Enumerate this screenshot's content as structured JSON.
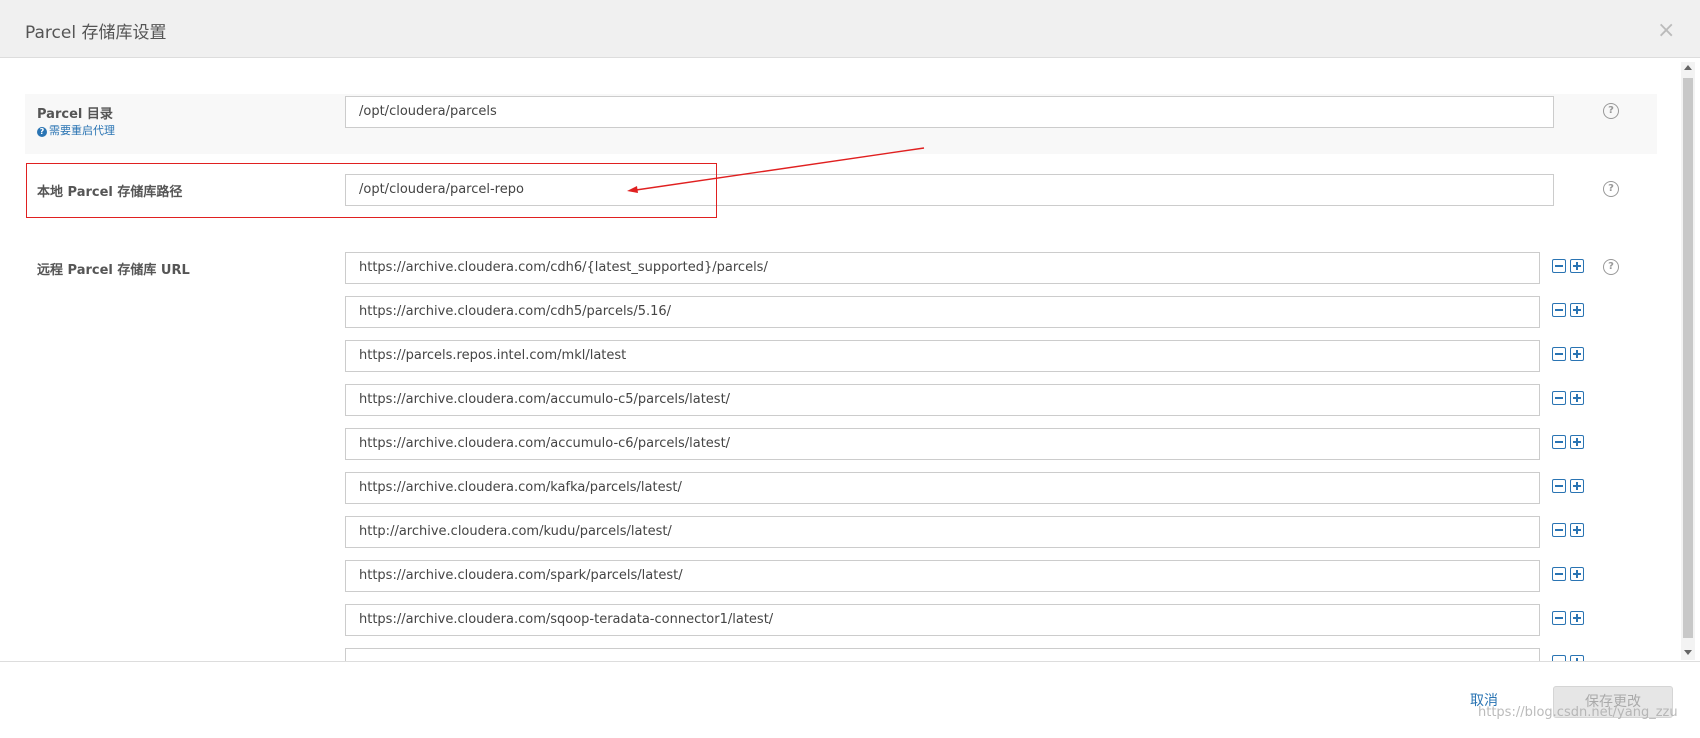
{
  "dialog": {
    "title": "Parcel 存储库设置"
  },
  "fields": {
    "parcel_dir": {
      "label": "Parcel 目录",
      "note": "需要重启代理",
      "value": "/opt/cloudera/parcels"
    },
    "local_repo": {
      "label": "本地 Parcel 存储库路径",
      "value": "/opt/cloudera/parcel-repo"
    },
    "remote_repo": {
      "label": "远程 Parcel 存储库 URL",
      "urls": [
        "https://archive.cloudera.com/cdh6/{latest_supported}/parcels/",
        "https://archive.cloudera.com/cdh5/parcels/5.16/",
        "https://parcels.repos.intel.com/mkl/latest",
        "https://archive.cloudera.com/accumulo-c5/parcels/latest/",
        "https://archive.cloudera.com/accumulo-c6/parcels/latest/",
        "https://archive.cloudera.com/kafka/parcels/latest/",
        "http://archive.cloudera.com/kudu/parcels/latest/",
        "https://archive.cloudera.com/spark/parcels/latest/",
        "https://archive.cloudera.com/sqoop-teradata-connector1/latest/"
      ]
    }
  },
  "footer": {
    "cancel_label": "取消",
    "save_label": "保存更改"
  },
  "watermark": "https://blog.csdn.net/yang_zzu",
  "colors": {
    "accent": "#2a74b3",
    "annotation": "#e02020"
  }
}
